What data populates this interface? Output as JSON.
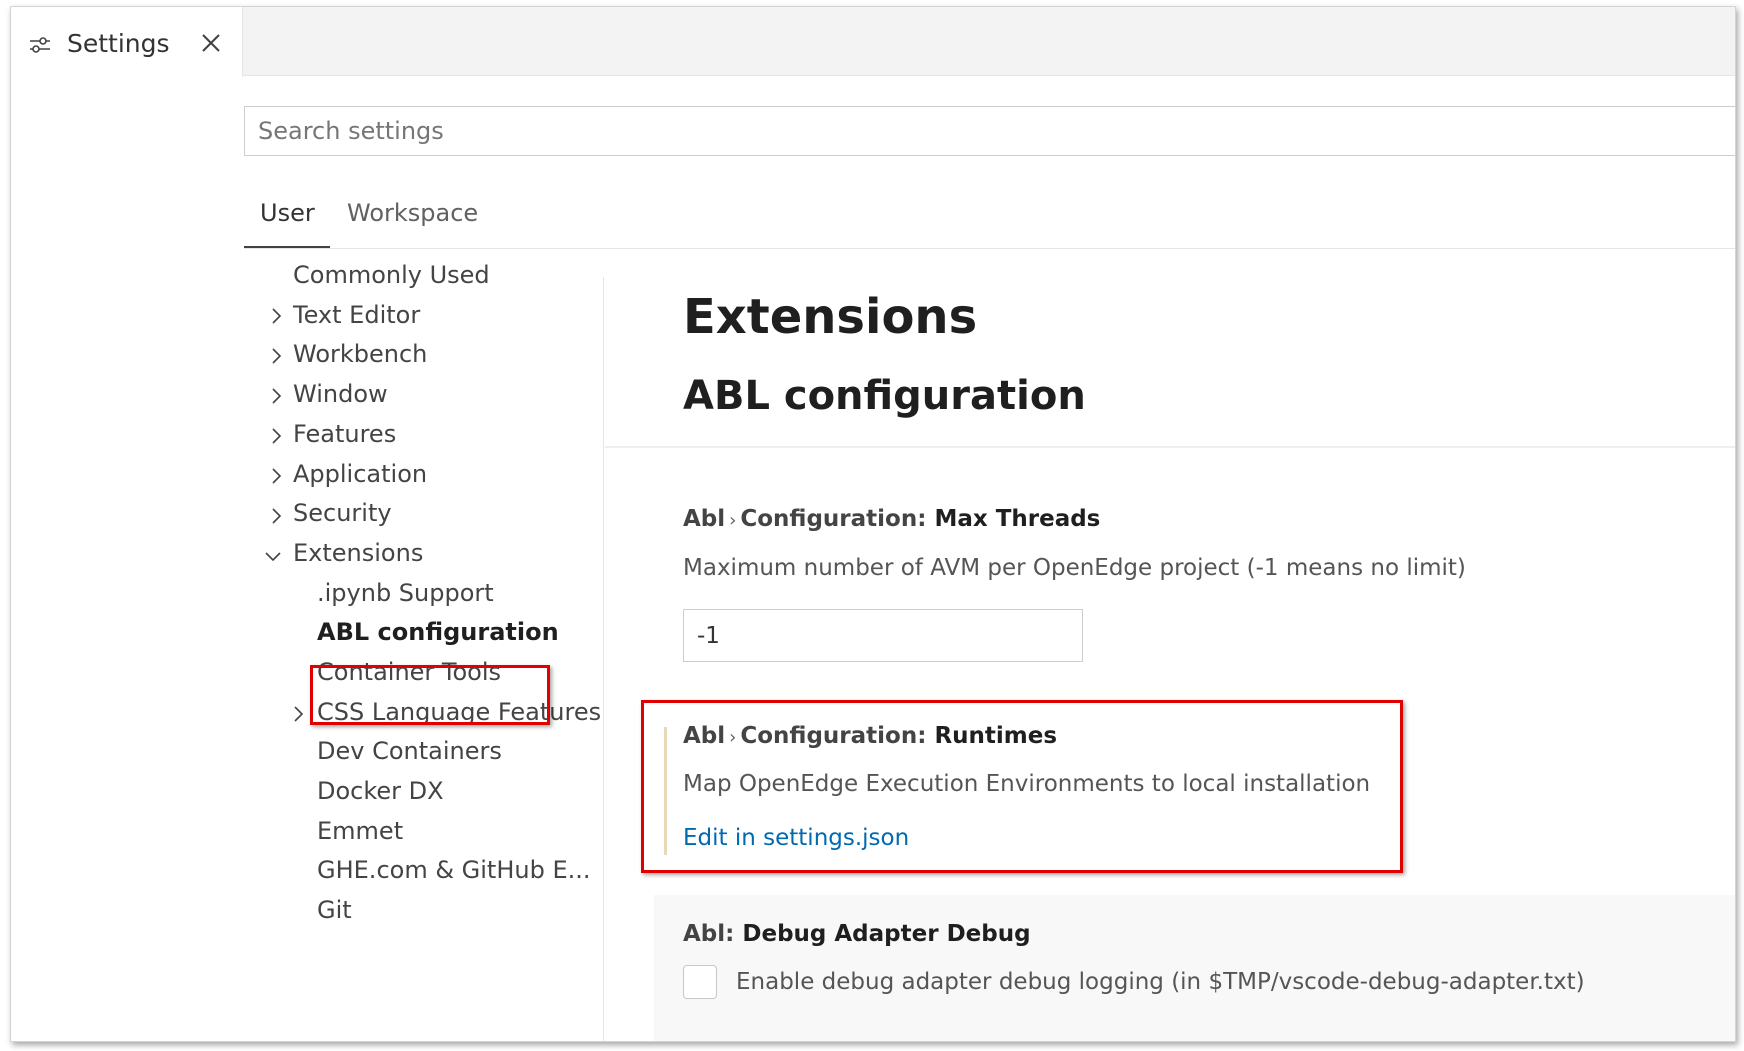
{
  "tab": {
    "label": "Settings",
    "icon": "settings-sliders-icon",
    "close_icon": "close-icon"
  },
  "search": {
    "placeholder": "Search settings"
  },
  "scope_tabs": {
    "user": "User",
    "workspace": "Workspace"
  },
  "toc": {
    "commonly_used": "Commonly Used",
    "text_editor": "Text Editor",
    "workbench": "Workbench",
    "window": "Window",
    "features": "Features",
    "application": "Application",
    "security": "Security",
    "extensions": "Extensions",
    "ipynb": ".ipynb Support",
    "abl": "ABL configuration",
    "container_tools": "Container Tools",
    "css": "CSS Language Features",
    "dev_containers": "Dev Containers",
    "docker_dx": "Docker DX",
    "emmet": "Emmet",
    "ghe": "GHE.com & GitHub E...",
    "git": "Git"
  },
  "main": {
    "section_title": "Extensions",
    "subsection_title": "ABL configuration",
    "settings": {
      "max_threads": {
        "category": "Abl",
        "group": "Configuration:",
        "name": "Max Threads",
        "description": "Maximum number of AVM per OpenEdge project (-1 means no limit)",
        "value": "-1"
      },
      "runtimes": {
        "category": "Abl",
        "group": "Configuration:",
        "name": "Runtimes",
        "description": "Map OpenEdge Execution Environments to local installation",
        "link": "Edit in settings.json"
      },
      "debug": {
        "category": "Abl:",
        "name": "Debug Adapter Debug",
        "description": "Enable debug adapter debug logging (in $TMP/vscode-debug-adapter.txt)"
      }
    }
  },
  "colors": {
    "highlight": "#e00000",
    "link": "#006ab1",
    "modified_indicator": "#e7d9b8"
  }
}
